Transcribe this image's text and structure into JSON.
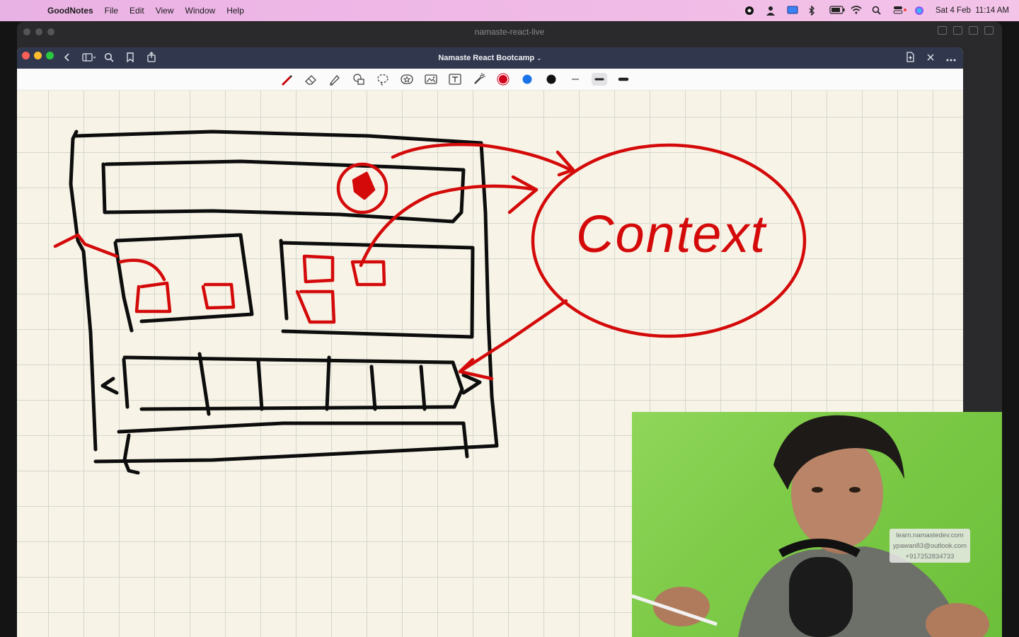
{
  "menubar": {
    "app_name": "GoodNotes",
    "items": [
      "File",
      "Edit",
      "View",
      "Window",
      "Help"
    ],
    "datetime": "Sat 4 Feb  11:14 AM"
  },
  "outer_window": {
    "title": "namaste-react-live"
  },
  "goodnotes": {
    "doc_title": "Namaste React Bootcamp",
    "doc_title_chevron": "⌄",
    "toolbar_tools": [
      "pen-icon",
      "eraser-icon",
      "highlighter-icon",
      "shapes-icon",
      "lasso-icon",
      "sticker-icon",
      "image-icon",
      "text-icon",
      "laser-pointer-icon"
    ],
    "colors": {
      "red": "#d0021b",
      "blue": "#1a73e8",
      "black": "#111111"
    },
    "canvas": {
      "handwritten_text": "Context"
    }
  },
  "webcam": {
    "watermark": {
      "line1": "learn.namastedev.com",
      "line2": "ypawan83@outlook.com",
      "line3": "+917252834733"
    }
  }
}
